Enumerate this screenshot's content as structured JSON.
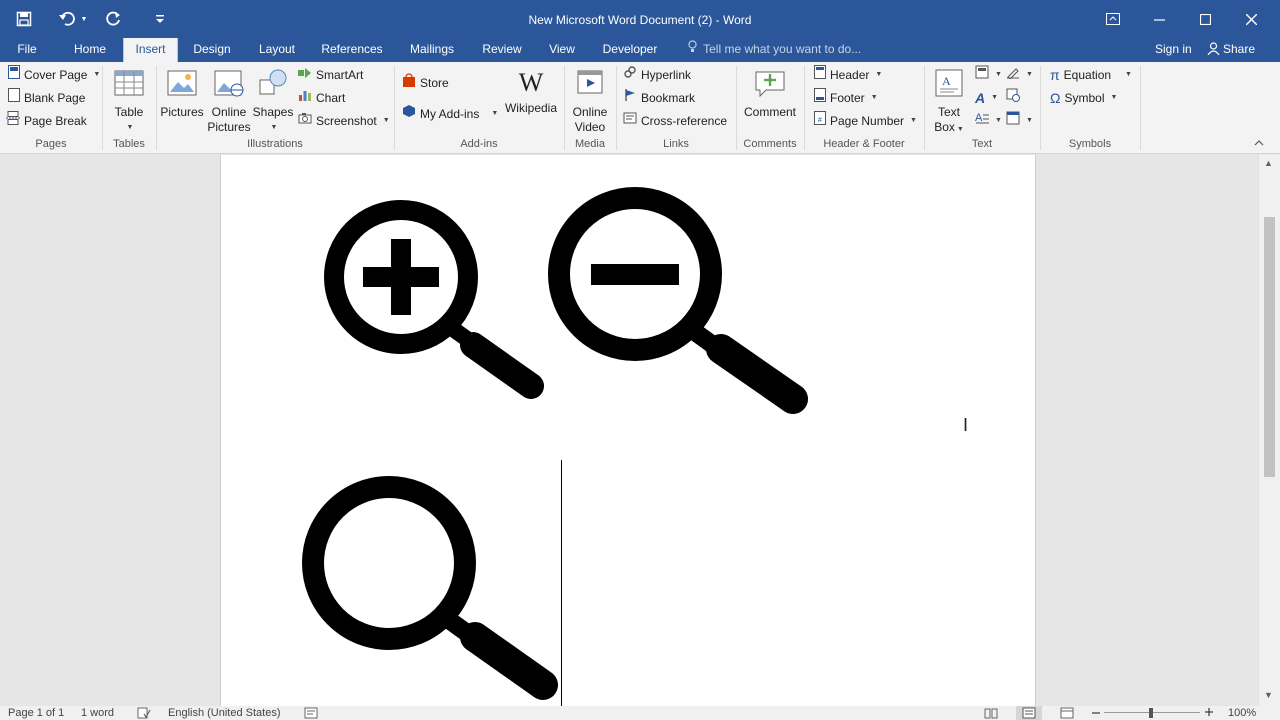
{
  "title_bar": {
    "document_title": "New Microsoft Word Document (2) - Word",
    "qat": {
      "save_icon": "save-icon",
      "undo_icon": "undo-icon",
      "redo_icon": "redo-icon",
      "customize_icon": "customize-qat-icon"
    },
    "window_controls": {
      "ribbon_display": "ribbon-display-icon",
      "minimize": "minimize-icon",
      "maximize": "maximize-icon",
      "close": "close-icon"
    }
  },
  "tabs": [
    {
      "label": "File"
    },
    {
      "label": "Home"
    },
    {
      "label": "Insert"
    },
    {
      "label": "Design"
    },
    {
      "label": "Layout"
    },
    {
      "label": "References"
    },
    {
      "label": "Mailings"
    },
    {
      "label": "Review"
    },
    {
      "label": "View"
    },
    {
      "label": "Developer"
    }
  ],
  "active_tab": "Insert",
  "tell_me_placeholder": "Tell me what you want to do...",
  "sign_in": "Sign in",
  "share": "Share",
  "ribbon": {
    "pages": {
      "label": "Pages",
      "cover_page": "Cover Page",
      "blank_page": "Blank Page",
      "page_break": "Page Break"
    },
    "tables": {
      "label": "Tables",
      "table": "Table"
    },
    "illustrations": {
      "label": "Illustrations",
      "pictures": "Pictures",
      "online_pictures_1": "Online",
      "online_pictures_2": "Pictures",
      "shapes": "Shapes",
      "smartart": "SmartArt",
      "chart": "Chart",
      "screenshot": "Screenshot"
    },
    "addins": {
      "label": "Add-ins",
      "store": "Store",
      "my_addins": "My Add-ins",
      "wikipedia": "Wikipedia"
    },
    "media": {
      "label": "Media",
      "online_video_1": "Online",
      "online_video_2": "Video"
    },
    "links": {
      "label": "Links",
      "hyperlink": "Hyperlink",
      "bookmark": "Bookmark",
      "cross_reference": "Cross-reference"
    },
    "comments": {
      "label": "Comments",
      "comment": "Comment"
    },
    "header_footer": {
      "label": "Header & Footer",
      "header": "Header",
      "footer": "Footer",
      "page_number": "Page Number"
    },
    "text": {
      "label": "Text",
      "text_box_1": "Text",
      "text_box_2": "Box"
    },
    "symbols": {
      "label": "Symbols",
      "equation": "Equation",
      "symbol": "Symbol"
    }
  },
  "document": {
    "images": [
      "zoom-in-magnifier-icon",
      "zoom-out-magnifier-icon",
      "magnifier-icon"
    ]
  },
  "status_bar": {
    "page": "Page 1 of 1",
    "words": "1 word",
    "language": "English (United States)",
    "zoom": "100%"
  }
}
